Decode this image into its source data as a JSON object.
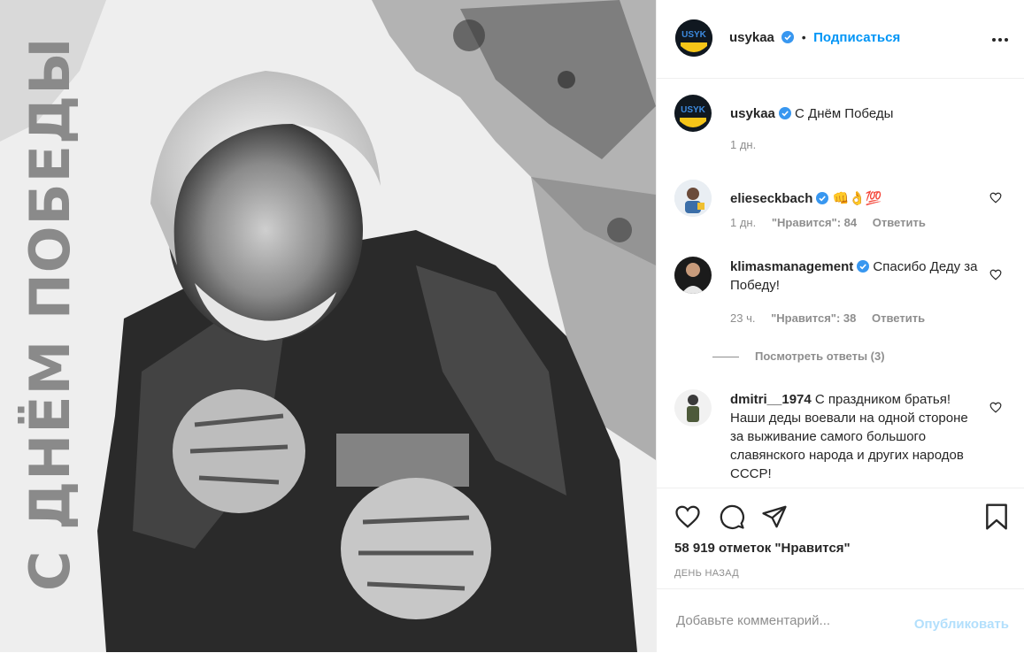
{
  "post": {
    "image_caption_text": "С ДНЁМ ПОБЕДЫ",
    "author": "usykaa",
    "follow_label": "Подписаться",
    "more_icon": "more-dots-icon",
    "caption": "С Днём Победы",
    "caption_time": "1 дн.",
    "likes": "58 919 отметок \"Нравится\"",
    "posted": "ДЕНЬ НАЗАД"
  },
  "comments": [
    {
      "user": "elieseckbach",
      "text": "👊👌💯",
      "time": "1 дн.",
      "likes": "\"Нравится\": 84",
      "reply": "Ответить"
    },
    {
      "user": "klimasmanagement",
      "text": "Спасибо Деду за Победу!",
      "time": "23 ч.",
      "likes": "\"Нравится\": 38",
      "reply": "Ответить"
    },
    {
      "user": "dmitri__1974",
      "text": "С праздником братья! Наши деды воевали на одной стороне за выживание самого большого славянского народа и других народов СССР!"
    }
  ],
  "view_replies": "Посмотреть ответы (3)",
  "add_comment": {
    "placeholder": "Добавьте комментарий...",
    "publish": "Опубликовать"
  },
  "colors": {
    "accent": "#0095f6",
    "verified": "#3897f0",
    "publish_disabled": "#b2dffc",
    "muted": "#8e8e8e"
  }
}
